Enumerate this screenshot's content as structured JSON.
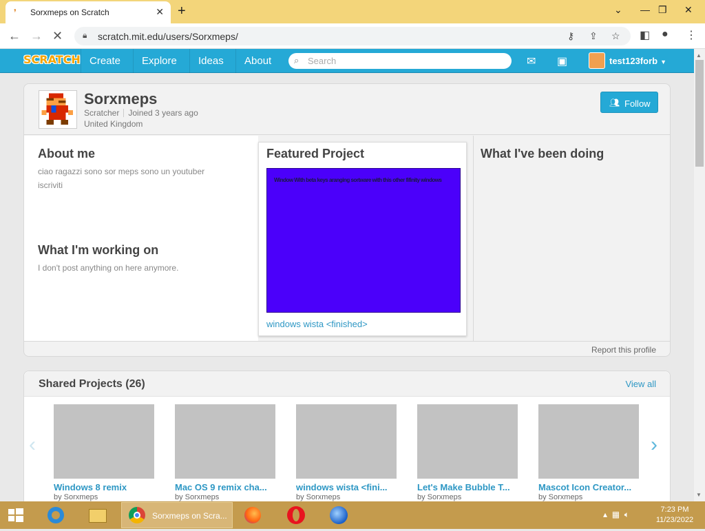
{
  "browser": {
    "tab_title": "Sorxmeps on Scratch",
    "url": "scratch.mit.edu/users/Sorxmeps/"
  },
  "nav": {
    "logo": "SCRATCH",
    "links": [
      "Create",
      "Explore",
      "Ideas",
      "About"
    ],
    "search_placeholder": "Search",
    "username": "test123forb"
  },
  "profile": {
    "username": "Sorxmeps",
    "role": "Scratcher",
    "joined": "Joined 3 years ago",
    "country": "United Kingdom",
    "follow_label": "Follow",
    "about_title": "About me",
    "about_text": "ciao ragazzi sono sor meps sono un youtuber iscriviti",
    "working_title": "What I'm working on",
    "working_text": "I don't post anything on here anymore.",
    "featured_title": "Featured Project",
    "featured_thumb_text": "Window With beta keys aranging sortware with this other fifinity windows",
    "featured_link": "windows wista <finished>",
    "doing_title": "What I've been doing",
    "report": "Report this profile"
  },
  "shared": {
    "title": "Shared Projects (26)",
    "view_all": "View all",
    "projects": [
      {
        "title": "Windows 8 remix",
        "by": "by Sorxmeps"
      },
      {
        "title": "Mac OS 9 remix cha...",
        "by": "by Sorxmeps"
      },
      {
        "title": "windows wista <fini...",
        "by": "by Sorxmeps"
      },
      {
        "title": "Let's Make Bubble T...",
        "by": "by Sorxmeps"
      },
      {
        "title": "Mascot Icon Creator...",
        "by": "by Sorxmeps"
      }
    ]
  },
  "taskbar": {
    "chrome_label": "Sorxmeps on Scra...",
    "time": "7:23 PM",
    "date": "11/23/2022"
  },
  "colors": {
    "scratch_blue": "#25a9d6",
    "featured_bg": "#4b00fa",
    "taskbar": "#c49b4d",
    "tabbar": "#f3d57a"
  }
}
